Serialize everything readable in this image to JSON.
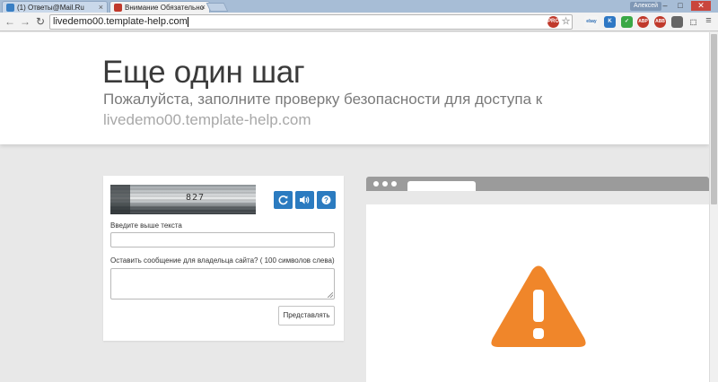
{
  "browser": {
    "tabs": [
      {
        "title": "(1) Ответы@Mail.Ru",
        "active": false,
        "favicon_color": "#3a7fc4"
      },
      {
        "title": "Внимание Обязательно",
        "active": true,
        "favicon_color": "#c0392b"
      }
    ],
    "user_name": "Алексей",
    "address": "livedemo00.template-help.com",
    "extensions": [
      {
        "name": "pro-icon",
        "label": "PRO",
        "color": "#c0392b"
      },
      {
        "name": "ebay-icon",
        "label": "ebay",
        "color": "#e9e9e9"
      },
      {
        "name": "k-icon",
        "label": "K",
        "color": "#2f78c4"
      },
      {
        "name": "shield-check-icon",
        "label": "✓",
        "color": "#3aa845"
      },
      {
        "name": "adblock-icon",
        "label": "ABP",
        "color": "#c0392b"
      },
      {
        "name": "adblock2-icon",
        "label": "ABB",
        "color": "#c0392b"
      },
      {
        "name": "lock-icon",
        "label": "",
        "color": "#666"
      },
      {
        "name": "ext-icon",
        "label": "",
        "color": "#777"
      }
    ]
  },
  "page": {
    "title": "Еще один шаг",
    "subtitle": "Пожалуйста, заполните проверку безопасности для доступа к",
    "domain": "livedemo00.template-help.com"
  },
  "captcha": {
    "image_text": "827",
    "input_label": "Введите выше текста",
    "input_value": "",
    "message_label": "Оставить сообщение для владельца сайта? ( 100 символов слева)",
    "message_value": "",
    "submit_label": "Представлять"
  },
  "colors": {
    "accent": "#2b7bc0",
    "warning": "#f0862a"
  }
}
